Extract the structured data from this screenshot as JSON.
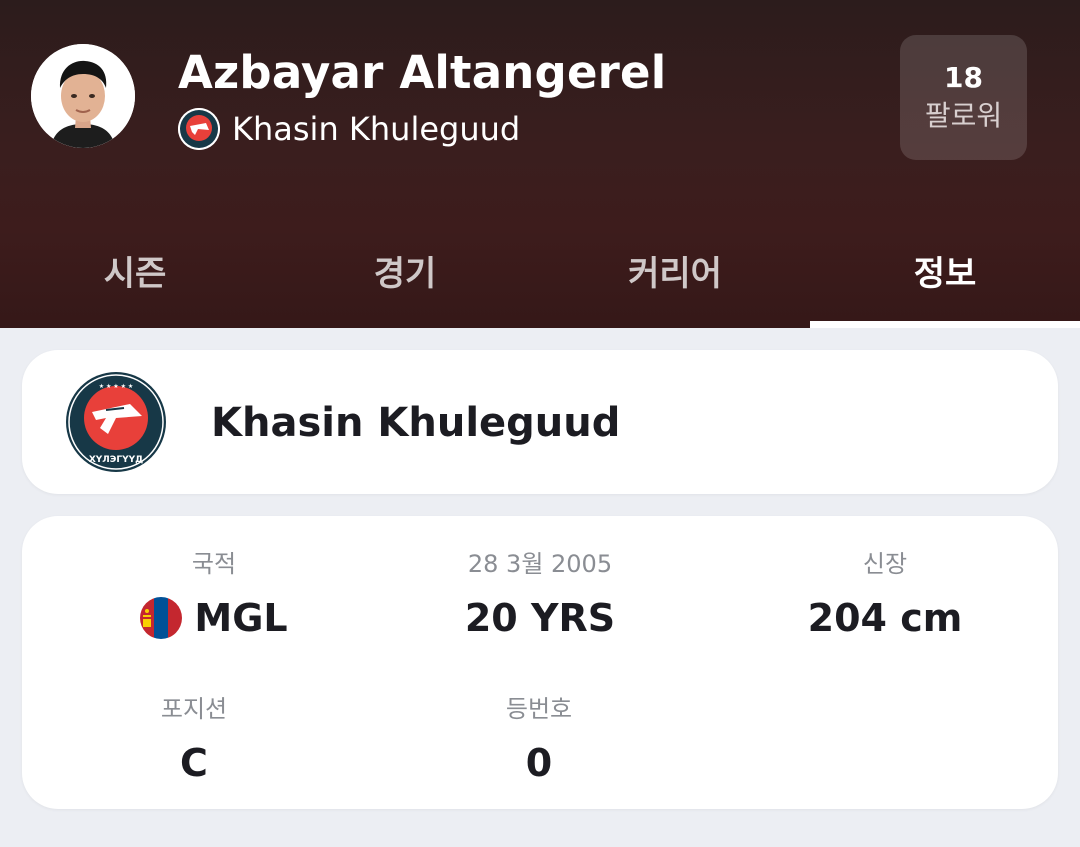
{
  "player": {
    "name": "Azbayar Altangerel",
    "team": "Khasin Khuleguud"
  },
  "follow": {
    "count": "18",
    "label": "팔로워"
  },
  "tabs": [
    {
      "label": "시즌",
      "active": false
    },
    {
      "label": "경기",
      "active": false
    },
    {
      "label": "커리어",
      "active": false
    },
    {
      "label": "정보",
      "active": true
    }
  ],
  "team_card": {
    "name": "Khasin Khuleguud",
    "logo_text": "ХҮЛЭГҮҮД"
  },
  "info": {
    "nationality": {
      "label": "국적",
      "value": "MGL"
    },
    "birth": {
      "label": "28 3월 2005",
      "value": "20 YRS"
    },
    "height": {
      "label": "신장",
      "value": "204 cm"
    },
    "position": {
      "label": "포지션",
      "value": "C"
    },
    "number": {
      "label": "등번호",
      "value": "0"
    }
  },
  "colors": {
    "header_bg": "#3a1e1e",
    "page_bg": "#eceef3",
    "flag_red": "#c4272f",
    "flag_blue": "#015197",
    "flag_gold": "#f9cf02",
    "team_red": "#e8403a",
    "team_navy": "#173847"
  },
  "icons": {
    "flag": "mongolia-flag-icon",
    "team_logo": "khasin-khuleguud-logo"
  }
}
